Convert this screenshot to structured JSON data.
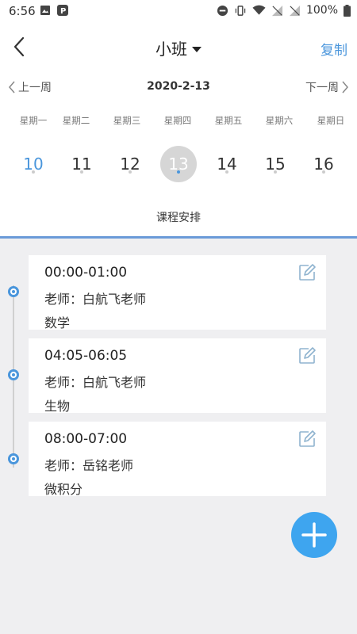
{
  "status_bar": {
    "time": "6:56",
    "battery": "100%"
  },
  "header": {
    "title": "小班",
    "copy_label": "复制"
  },
  "week_nav": {
    "prev_label": "上一周",
    "date": "2020-2-13",
    "next_label": "下一周"
  },
  "week": {
    "days": [
      {
        "name": "星期一",
        "num": "10",
        "state": "today"
      },
      {
        "name": "星期二",
        "num": "11",
        "state": "normal"
      },
      {
        "name": "星期三",
        "num": "12",
        "state": "normal"
      },
      {
        "name": "星期四",
        "num": "13",
        "state": "selected"
      },
      {
        "name": "星期五",
        "num": "14",
        "state": "normal"
      },
      {
        "name": "星期六",
        "num": "15",
        "state": "normal"
      },
      {
        "name": "星期日",
        "num": "16",
        "state": "normal"
      }
    ],
    "section_label": "课程安排"
  },
  "schedule": [
    {
      "time": "00:00-01:00",
      "teacher": "老师：白航飞老师",
      "subject": "数学"
    },
    {
      "time": "04:05-06:05",
      "teacher": "老师：白航飞老师",
      "subject": "生物"
    },
    {
      "time": "08:00-07:00",
      "teacher": "老师：岳铭老师",
      "subject": "微积分"
    }
  ],
  "colors": {
    "accent": "#4a96dc",
    "fab": "#3ea5ef"
  },
  "icons": {
    "back": "chevron-left-icon",
    "edit": "edit-icon",
    "add": "plus-icon"
  }
}
